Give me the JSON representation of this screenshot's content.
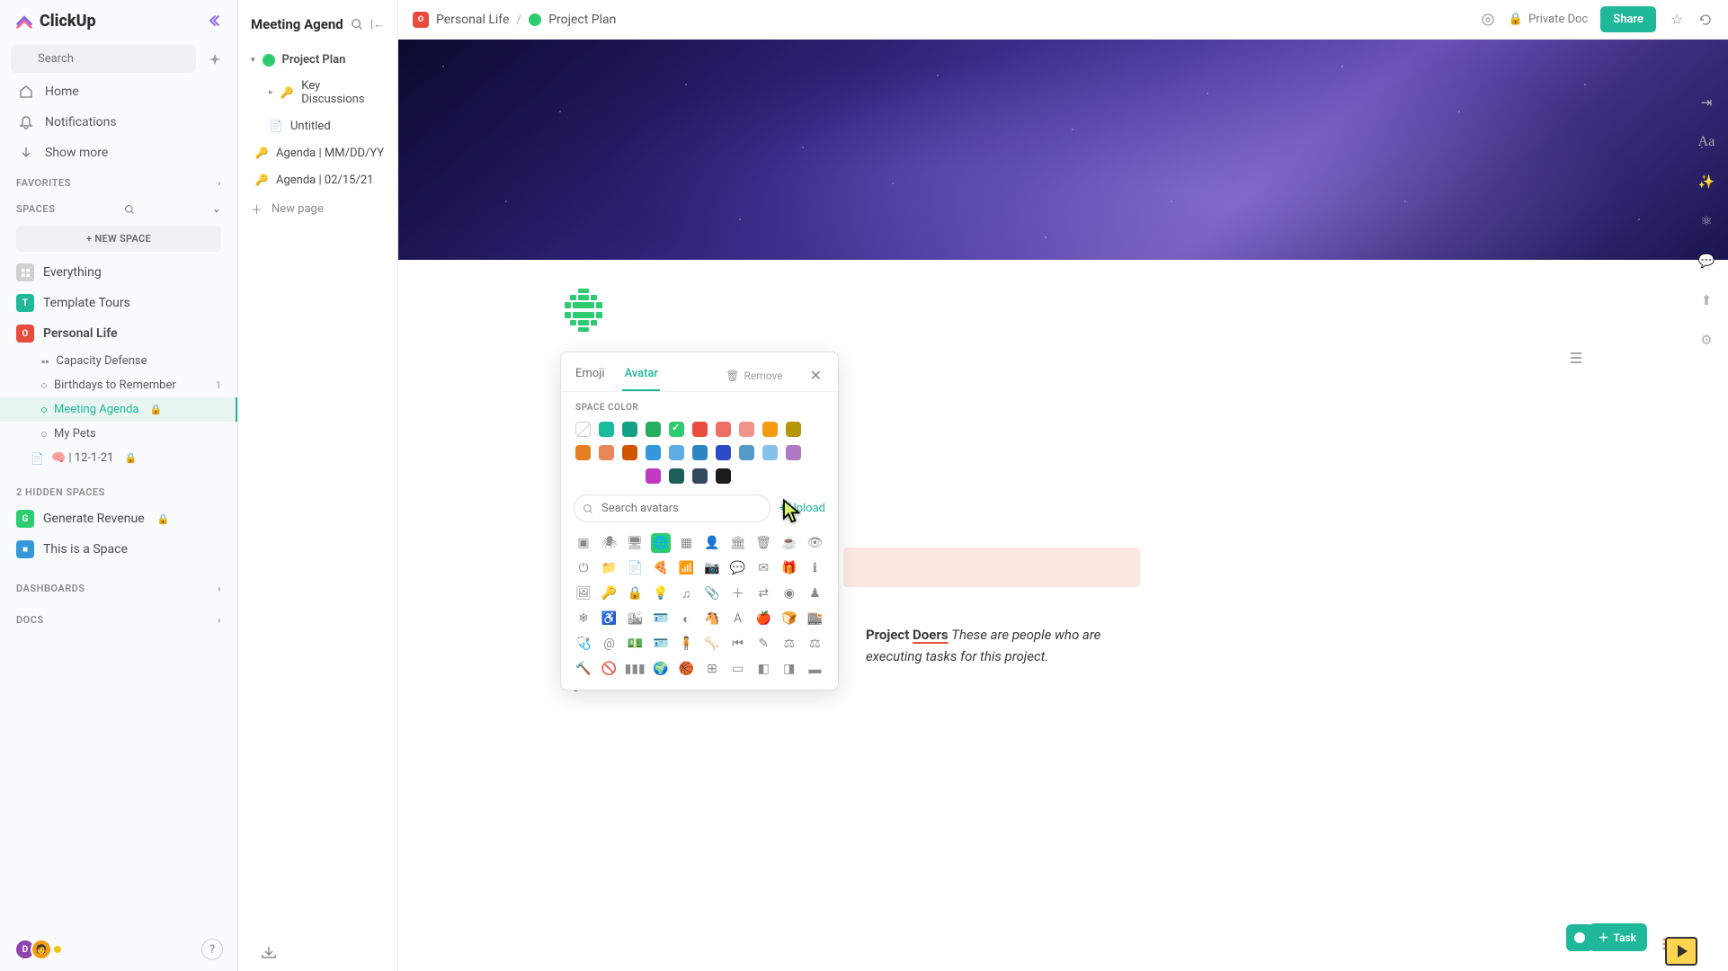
{
  "logo": "ClickUp",
  "search_placeholder": "Search",
  "nav": [
    {
      "icon": "home",
      "label": "Home"
    },
    {
      "icon": "bell",
      "label": "Notifications"
    },
    {
      "icon": "down",
      "label": "Show more"
    }
  ],
  "sections": {
    "favorites": "FAVORITES",
    "spaces": "SPACES",
    "hidden": "2 HIDDEN SPACES",
    "dashboards": "DASHBOARDS",
    "docs": "DOCS"
  },
  "new_space": "+  NEW SPACE",
  "spaces": [
    {
      "label": "Everything",
      "color": "#c0c0c0",
      "initial": "⊞"
    },
    {
      "label": "Template Tours",
      "color": "#1fb89a",
      "initial": "T"
    },
    {
      "label": "Personal Life",
      "color": "#e74c3c",
      "initial": "O",
      "bold": true
    }
  ],
  "personal_children": [
    {
      "type": "folder",
      "label": "Capacity Defense"
    },
    {
      "type": "list",
      "label": "Birthdays to Remember",
      "badge": "1"
    },
    {
      "type": "list",
      "label": "Meeting Agenda",
      "active": true,
      "lock": true
    },
    {
      "type": "list",
      "label": "My Pets"
    },
    {
      "type": "doc",
      "label": "🧠 | 12-1-21",
      "lock": true
    }
  ],
  "hidden_spaces": [
    {
      "label": "Generate Revenue",
      "color": "#2ecc71",
      "initial": "G",
      "lock": true
    },
    {
      "label": "This is a Space",
      "color": "#3498db",
      "initial": "■"
    }
  ],
  "outline": {
    "title": "Meeting Agenda",
    "root": "Project Plan",
    "children": [
      {
        "icon": "key",
        "label": "Key Discussions"
      },
      {
        "icon": "page",
        "label": "Untitled"
      }
    ],
    "siblings": [
      {
        "icon": "keyalt",
        "label": "Agenda | MM/DD/YY"
      },
      {
        "icon": "keyalt",
        "label": "Agenda | 02/15/21"
      }
    ],
    "new_page": "New page"
  },
  "breadcrumb": {
    "space": "Personal Life",
    "doc": "Project Plan"
  },
  "topbar": {
    "private": "Private Doc",
    "share": "Share"
  },
  "picker": {
    "tabs": [
      "Emoji",
      "Avatar"
    ],
    "active_tab": "Avatar",
    "remove": "Remove",
    "section_label": "SPACE COLOR",
    "colors_row1": [
      "none",
      "#1abc9c",
      "#16a085",
      "#27ae60",
      "#2ecc71",
      "#e74c3c",
      "#ec7063",
      "#f1948a",
      "#f39c12",
      "#b7950b"
    ],
    "colors_row2": [
      "#e67e22",
      "#e8885a",
      "#d35400",
      "#3498db",
      "#5dade2",
      "#2e86c1",
      "#2e4bc7",
      "#5499c7",
      "#85c1e9",
      "#af7ac5"
    ],
    "colors_row3": [
      "#c039c0",
      "#1e5f5b",
      "#34495e",
      "#1c1c1c"
    ],
    "selected_color": "#2ecc71",
    "search_placeholder": "Search avatars",
    "upload": "+ Upload",
    "avatar_icons": [
      [
        "address-book",
        "bug",
        "desktop",
        "globe",
        "calendar",
        "user",
        "bank",
        "trash",
        "coffee",
        "eye"
      ],
      [
        "power",
        "folder",
        "file",
        "pizza",
        "wifi",
        "camera",
        "comment",
        "envelope",
        "gift",
        "info"
      ],
      [
        "image",
        "key",
        "lock",
        "lightbulb",
        "music",
        "paperclip",
        "plus",
        "share",
        "user-circle",
        "chess"
      ],
      [
        "snowflake",
        "accessibility",
        "image-alt",
        "id",
        "adjust",
        "horse",
        "font",
        "apple",
        "bread",
        "store"
      ],
      [
        "stethoscope",
        "at",
        "cash",
        "id-card",
        "child",
        "bone",
        "rewind",
        "pen",
        "balance",
        "balance-alt"
      ],
      [
        "gavel",
        "ban",
        "barcode",
        "globe2",
        "basketball",
        "sitemap",
        "battery-empty",
        "battery-half",
        "battery-low",
        "battery-full"
      ]
    ],
    "selected_avatar": "globe"
  },
  "body": {
    "project": "Project",
    "doers": "Doers",
    "rest": "These are people who are executing tasks for this project."
  },
  "task_btn": "Task"
}
